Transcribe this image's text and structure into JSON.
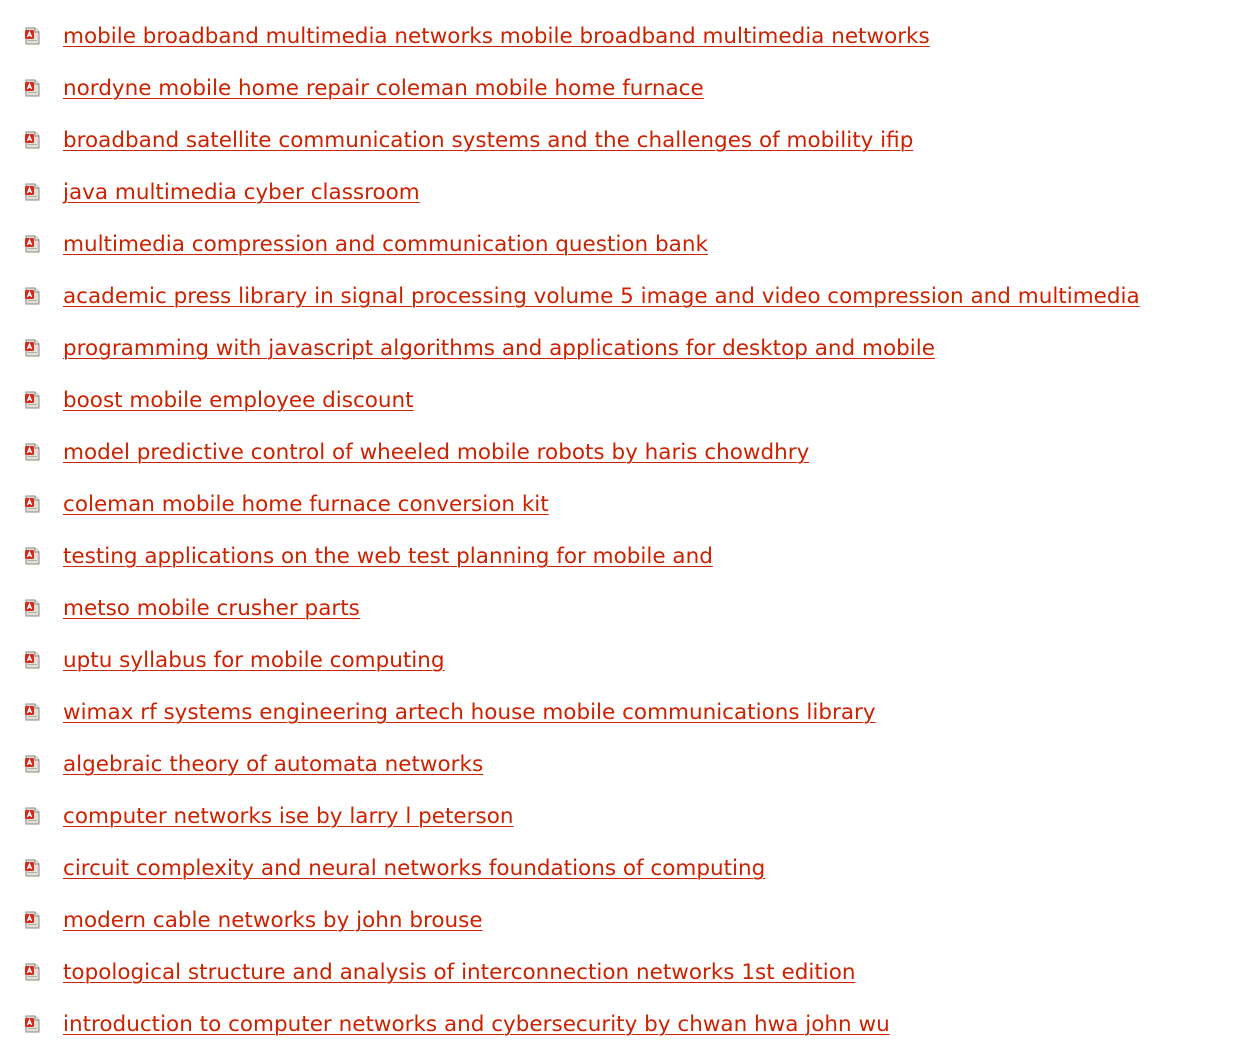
{
  "colors": {
    "link": "#cc2200",
    "icon_red": "#d42a1c",
    "icon_page": "#d9d6cf"
  },
  "icon": "pdf-file-icon",
  "items": [
    {
      "label": "mobile broadband multimedia networks mobile broadband multimedia networks"
    },
    {
      "label": "nordyne mobile home repair coleman mobile home furnace"
    },
    {
      "label": "broadband satellite communication systems and the challenges of mobility ifip"
    },
    {
      "label": "java multimedia cyber classroom"
    },
    {
      "label": "multimedia compression and communication question bank"
    },
    {
      "label": "academic press library in signal processing volume 5 image and video compression and multimedia"
    },
    {
      "label": "programming with javascript algorithms and applications for desktop and mobile"
    },
    {
      "label": "boost mobile employee discount"
    },
    {
      "label": "model predictive control of wheeled mobile robots by haris chowdhry"
    },
    {
      "label": "coleman mobile home furnace conversion kit"
    },
    {
      "label": "testing applications on the web test planning for mobile and"
    },
    {
      "label": "metso mobile crusher parts"
    },
    {
      "label": "uptu syllabus for mobile computing"
    },
    {
      "label": "wimax rf systems engineering artech house mobile communications library"
    },
    {
      "label": "algebraic theory of automata networks"
    },
    {
      "label": "computer networks ise by larry l peterson"
    },
    {
      "label": "circuit complexity and neural networks foundations of computing"
    },
    {
      "label": "modern cable networks by john brouse"
    },
    {
      "label": "topological structure and analysis of interconnection networks 1st edition"
    },
    {
      "label": "introduction to computer networks and cybersecurity by chwan hwa john wu"
    }
  ]
}
